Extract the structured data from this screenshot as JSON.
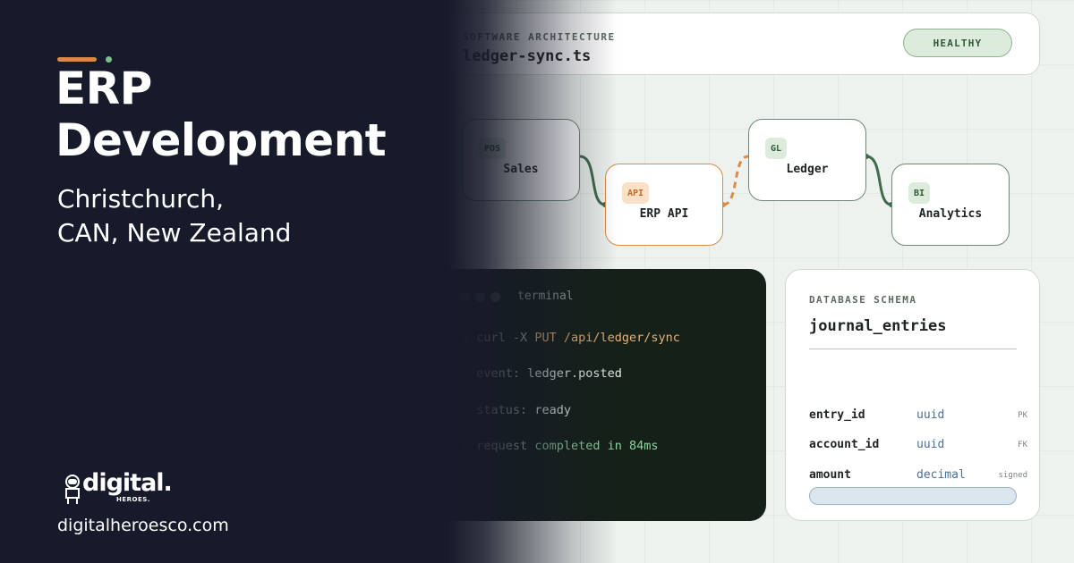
{
  "brand": {
    "accent_orange": "#d58b48",
    "accent_green": "#79c28c",
    "panel_bg": "#171a2a"
  },
  "hero": {
    "headline_line1": "ERP",
    "headline_line2": "Development",
    "location_line1": "Christchurch,",
    "location_line2": "CAN, New Zealand"
  },
  "topbar": {
    "overline": "SOFTWARE ARCHITECTURE",
    "filename": "ledger-sync.ts",
    "status_badge": "HEALTHY"
  },
  "nodes": [
    {
      "tag": "POS",
      "label": "Sales"
    },
    {
      "tag": "API",
      "label": "ERP API"
    },
    {
      "tag": "GL",
      "label": "Ledger"
    },
    {
      "tag": "BI",
      "label": "Analytics"
    }
  ],
  "terminal": {
    "title": "terminal",
    "lines": [
      {
        "prefix": "$",
        "text": "curl -X ",
        "highlight": "PUT /api/ledger/sync"
      },
      {
        "prefix": "→",
        "text": "event: ",
        "value": "ledger.posted"
      },
      {
        "prefix": "→",
        "text": "status: ",
        "value": "ready"
      },
      {
        "prefix": "/",
        "text": "request ",
        "done": "completed in 84ms"
      }
    ]
  },
  "schema": {
    "overline": "DATABASE SCHEMA",
    "table_name": "journal_entries",
    "rows": [
      {
        "field": "entry_id",
        "type": "uuid",
        "key": "PK"
      },
      {
        "field": "account_id",
        "type": "uuid",
        "key": "FK"
      },
      {
        "field": "amount",
        "type": "decimal",
        "key": "signed"
      }
    ]
  },
  "logo": {
    "word": "digital.",
    "sub": "HEROES."
  },
  "footer": {
    "website": "digitalheroesco.com"
  }
}
